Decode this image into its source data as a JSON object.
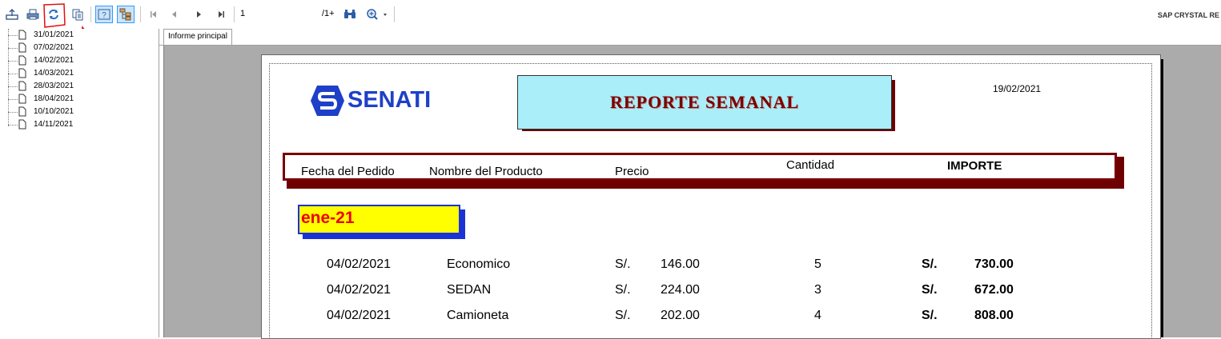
{
  "toolbar": {
    "buttons": [
      "export-icon",
      "print-icon",
      "refresh-icon",
      "copy-icon",
      "help-icon",
      "group-tree-icon"
    ],
    "nav": [
      "first-page-icon",
      "previous-page-icon",
      "next-page-icon",
      "last-page-icon"
    ],
    "page_value": "1",
    "page_total": "/1+",
    "search": "binoculars-icon",
    "zoom": "zoom-icon",
    "brand": "SAP CRYSTAL RE"
  },
  "tree": {
    "items": [
      "31/01/2021",
      "07/02/2021",
      "14/02/2021",
      "14/03/2021",
      "28/03/2021",
      "18/04/2021",
      "10/10/2021",
      "14/11/2021"
    ]
  },
  "tabs": {
    "main_label": "Informe principal"
  },
  "report": {
    "logo_text": "SENATI",
    "title": "REPORTE SEMANAL",
    "date": "19/02/2021",
    "headers": {
      "fecha": "Fecha del Pedido",
      "producto": "Nombre del Producto",
      "precio": "Precio",
      "cantidad": "Cantidad",
      "importe": "IMPORTE"
    },
    "group_label": "ene-21",
    "rows": [
      {
        "fecha": "04/02/2021",
        "producto": "Economico",
        "currency": "S/.",
        "precio": "146.00",
        "cantidad": "5",
        "importe_currency": "S/.",
        "importe": "730.00"
      },
      {
        "fecha": "04/02/2021",
        "producto": "SEDAN",
        "currency": "S/.",
        "precio": "224.00",
        "cantidad": "3",
        "importe_currency": "S/.",
        "importe": "672.00"
      },
      {
        "fecha": "04/02/2021",
        "producto": "Camioneta",
        "currency": "S/.",
        "precio": "202.00",
        "cantidad": "4",
        "importe_currency": "S/.",
        "importe": "808.00"
      }
    ]
  },
  "colors": {
    "title_bg": "#a9eef8",
    "title_text": "#7a0000",
    "header_border": "#7a0000",
    "group_bg": "#ffff00",
    "group_text": "#ee0000",
    "logo_blue": "#1e40c8",
    "annotation_red": "#e01010"
  }
}
